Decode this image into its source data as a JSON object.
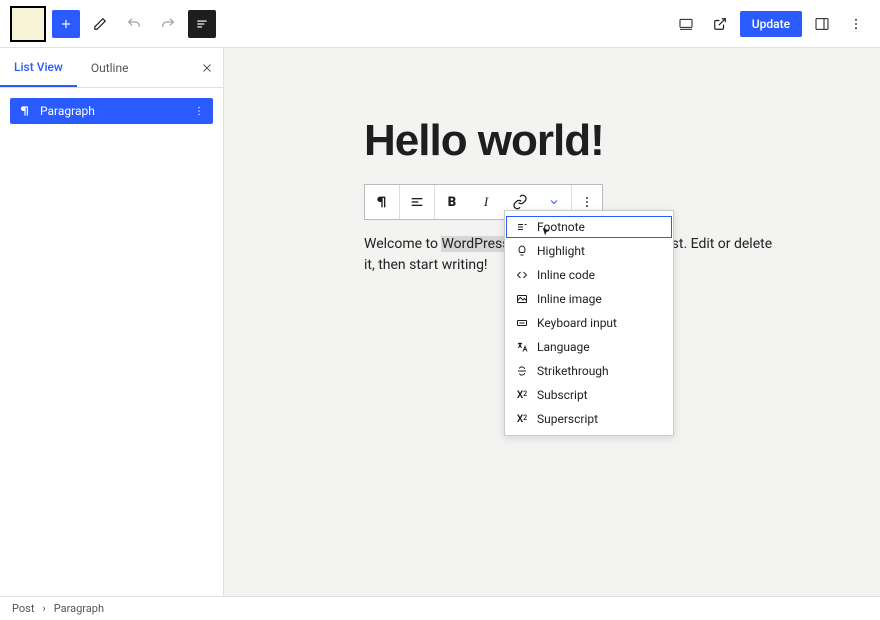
{
  "topbar": {
    "update_label": "Update"
  },
  "sidebar": {
    "tabs": {
      "listview": "List View",
      "outline": "Outline"
    },
    "item_label": "Paragraph"
  },
  "content": {
    "title": "Hello world!",
    "para_start": "Welcome to ",
    "para_highlight": "WordPress",
    "para_cont1": ". ",
    "para_hidden": "",
    "para_cont2": "st. Edit or delete it, then start writing!"
  },
  "dropdown": {
    "footnote": "Footnote",
    "highlight": "Highlight",
    "inline_code": "Inline code",
    "inline_image": "Inline image",
    "keyboard_input": "Keyboard input",
    "language": "Language",
    "strikethrough": "Strikethrough",
    "subscript": "Subscript",
    "superscript": "Superscript"
  },
  "footer": {
    "crumb1": "Post",
    "sep": "›",
    "crumb2": "Paragraph"
  }
}
